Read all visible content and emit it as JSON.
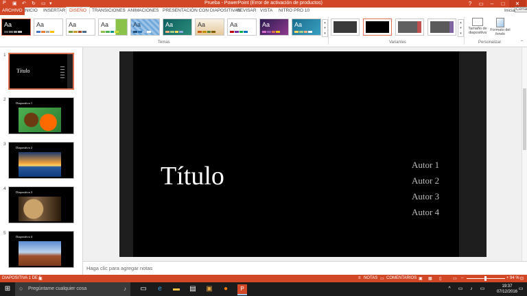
{
  "window": {
    "title": "Prueba - PowerPoint (Error de activación de productos)",
    "controls": [
      "?",
      "▭",
      "–",
      "□",
      "✕"
    ],
    "signin": "Iniciar",
    "signin_tooltip": "Cerrar"
  },
  "tabs": [
    "ARCHIVO",
    "INICIO",
    "INSERTAR",
    "DISEÑO",
    "TRANSICIONES",
    "ANIMACIONES",
    "PRESENTACIÓN CON DIAPOSITIVAS",
    "REVISAR",
    "VISTA",
    "NITRO PRO 10"
  ],
  "active_tab": "DISEÑO",
  "ribbon": {
    "groups": {
      "themes": "Temas",
      "variants": "Variantes",
      "customize": "Personalizar"
    },
    "theme_sample_text": "Aa",
    "buttons": {
      "slide_size": "Tamaño de diapositiva",
      "format_background": "Formato del fondo"
    }
  },
  "thumbnails": [
    {
      "number": "1",
      "title": "Título"
    },
    {
      "number": "2",
      "title": "Diapositiva 1"
    },
    {
      "number": "3",
      "title": "Diapositiva 2"
    },
    {
      "number": "4",
      "title": "Diapositiva 3"
    },
    {
      "number": "5",
      "title": "Diapositiva 4"
    }
  ],
  "slide": {
    "title": "Título",
    "authors": [
      "Autor 1",
      "Autor 2",
      "Autor 3",
      "Autor 4"
    ]
  },
  "notes_placeholder": "Haga clic para agregar notas",
  "status": {
    "slide_counter": "DIAPOSITIVA 1 DE 5",
    "notes": "NOTAS",
    "comments": "COMENTARIOS",
    "zoom": "94 %"
  },
  "taskbar": {
    "search_placeholder": "Pregúntame cualquier cosa",
    "time": "19:37",
    "date": "07/12/2016"
  },
  "colors": {
    "accent": "#d24726",
    "slide_bg": "#000000"
  }
}
